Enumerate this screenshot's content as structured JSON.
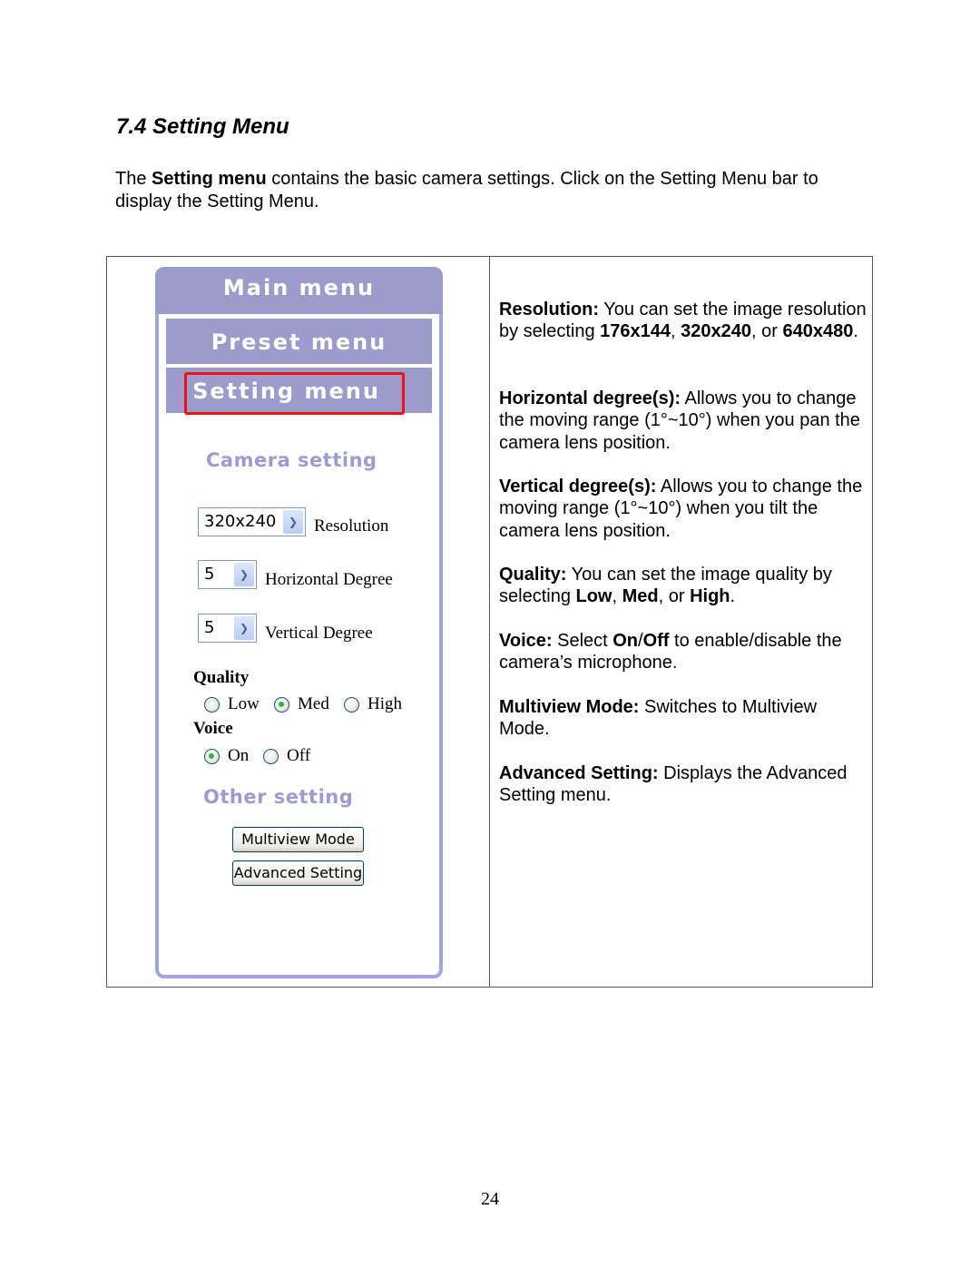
{
  "heading": "7.4 Setting Menu",
  "intro": {
    "pre": "The ",
    "bold": "Setting menu",
    "post": " contains the basic camera settings. Click on the Setting Menu bar to display the Setting Menu."
  },
  "ui": {
    "colors": {
      "menu_bar": "#9c9ccc",
      "highlight": "#ee1111",
      "section_title": "#9c9cd0",
      "radio_selected": "#2cb53a"
    },
    "main_menu": "Main menu",
    "preset_menu": "Preset menu",
    "setting_menu": "Setting menu",
    "camera_setting_title": "Camera setting",
    "resolution": {
      "value": "320x240",
      "label": "Resolution",
      "icon": "chevron-down-icon"
    },
    "horizontal": {
      "value": "5",
      "label": "Horizontal Degree",
      "icon": "chevron-down-icon"
    },
    "vertical": {
      "value": "5",
      "label": "Vertical Degree",
      "icon": "chevron-down-icon"
    },
    "quality": {
      "label": "Quality",
      "options": [
        "Low",
        "Med",
        "High"
      ],
      "selected": "Med"
    },
    "voice": {
      "label": "Voice",
      "options": [
        "On",
        "Off"
      ],
      "selected": "On"
    },
    "other_setting_title": "Other setting",
    "multiview_button": "Multiview Mode",
    "advanced_button": "Advanced Setting"
  },
  "descriptions": [
    {
      "term": "Resolution:",
      "parts": [
        " You can set the image resolution by selecting ",
        {
          "b": "176x144"
        },
        ", ",
        {
          "b": "320x240"
        },
        ", or ",
        {
          "b": "640x480"
        },
        "."
      ]
    },
    {
      "term": "Horizontal degree(s):",
      "parts": [
        " Allows you to change the moving range (1°~10°) when you pan the camera lens position."
      ]
    },
    {
      "term": "Vertical degree(s):",
      "parts": [
        " Allows you to change the moving range (1°~10°) when you tilt the camera lens position."
      ]
    },
    {
      "term": "Quality:",
      "parts": [
        " You can set the image quality by selecting ",
        {
          "b": "Low"
        },
        ", ",
        {
          "b": "Med"
        },
        ", or ",
        {
          "b": "High"
        },
        "."
      ]
    },
    {
      "term": "Voice:",
      "parts": [
        " Select ",
        {
          "b": "On"
        },
        "/",
        {
          "b": "Off"
        },
        " to enable/disable the camera’s microphone."
      ]
    },
    {
      "term": "Multiview Mode:",
      "parts": [
        " Switches to Multiview Mode."
      ]
    },
    {
      "term": "Advanced Setting:",
      "parts": [
        " Displays the Advanced Setting menu."
      ]
    }
  ],
  "page_number": "24"
}
